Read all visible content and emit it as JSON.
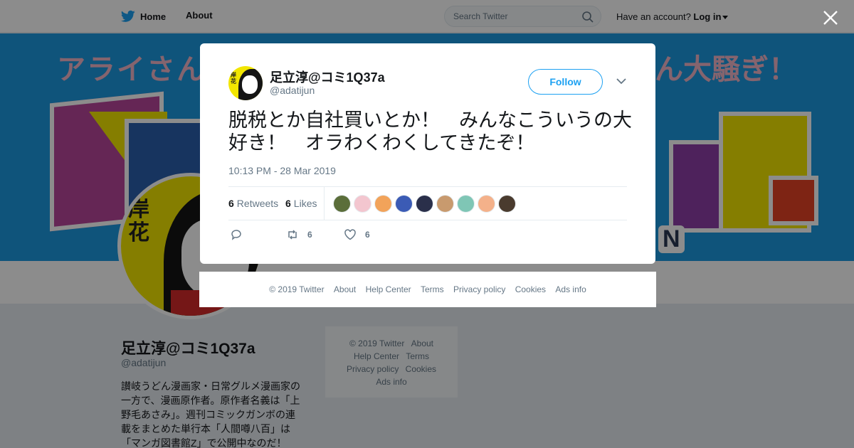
{
  "nav": {
    "home_label": "Home",
    "about_label": "About"
  },
  "search": {
    "placeholder": "Search Twitter"
  },
  "account": {
    "prompt": "Have an account?",
    "login_label": "Log in"
  },
  "banner": {
    "title_left": "アライさん",
    "title_right": "ん大騒ぎ！",
    "letter": "N"
  },
  "profile": {
    "name": "足立淳@コミ1Q37a",
    "handle": "@adatijun",
    "bio": "讃岐うどん漫画家・日常グルメ漫画家の一方で、漫画原作者。原作者名義は「上野毛あさみ」。週刊コミックガンボの連載をまとめた単行本「人間噂八百」は「マンガ図書館Z」で公開中なのだ！",
    "avatar_kanji": "岸花"
  },
  "side_footer": {
    "links": [
      "© 2019 Twitter",
      "About",
      "Help Center",
      "Terms",
      "Privacy policy",
      "Cookies",
      "Ads info"
    ]
  },
  "tweet": {
    "author_name": "足立淳@コミ1Q37a",
    "author_handle": "@adatijun",
    "follow_label": "Follow",
    "text": "脱税とか自社買いとか！　みんなこういうの大好き！　オラわくわくしてきたぞ！",
    "timestamp": "10:13 PM - 28 Mar 2019",
    "retweets_count": "6",
    "retweets_label": "Retweets",
    "likes_count": "6",
    "likes_label": "Likes",
    "action_retweet_count": "6",
    "action_like_count": "6",
    "liker_colors": [
      "#5b6e3a",
      "#f3c6cf",
      "#f2a35a",
      "#3b5bb5",
      "#2a2f4a",
      "#c89a6e",
      "#7fc6b5",
      "#f4b18a",
      "#4a3b2e"
    ]
  },
  "modal_footer": {
    "links": [
      "© 2019 Twitter",
      "About",
      "Help Center",
      "Terms",
      "Privacy policy",
      "Cookies",
      "Ads info"
    ]
  },
  "colors": {
    "accent": "#1da1f2",
    "banner": "#1c9ae0"
  }
}
